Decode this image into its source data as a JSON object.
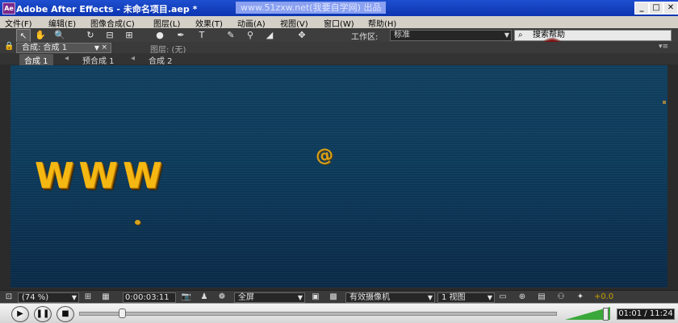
{
  "window": {
    "app_icon": "Ae",
    "title": "Adobe After Effects - 未命名项目.aep *",
    "watermark": "www.51zxw.net(我要自学网) 出品",
    "buttons": {
      "minimize": "_",
      "maximize": "□",
      "close": "✕"
    }
  },
  "menu": {
    "items": [
      "文件(F)",
      "编辑(E)",
      "图像合成(C)",
      "图层(L)",
      "效果(T)",
      "动画(A)",
      "视图(V)",
      "窗口(W)",
      "帮助(H)"
    ]
  },
  "toolbar": {
    "tools": [
      {
        "name": "selection-tool-icon",
        "glyph": "↖"
      },
      {
        "name": "hand-tool-icon",
        "glyph": "✋"
      },
      {
        "name": "zoom-tool-icon",
        "glyph": "🔍"
      },
      {
        "name": "rotate-tool-icon",
        "glyph": "↻"
      },
      {
        "name": "camera-tool-icon",
        "glyph": "⊟"
      },
      {
        "name": "pan-behind-tool-icon",
        "glyph": "⊞"
      },
      {
        "name": "ellipse-tool-icon",
        "glyph": "●"
      },
      {
        "name": "pen-tool-icon",
        "glyph": "✒"
      },
      {
        "name": "text-tool-icon",
        "glyph": "T"
      },
      {
        "name": "brush-tool-icon",
        "glyph": "✎"
      },
      {
        "name": "clone-stamp-tool-icon",
        "glyph": "⚲"
      },
      {
        "name": "eraser-tool-icon",
        "glyph": "◢"
      },
      {
        "name": "puppet-tool-icon",
        "glyph": "✥"
      }
    ],
    "workspace_label": "工作区:",
    "workspace_value": "标准",
    "search_placeholder": "搜索帮助"
  },
  "panel": {
    "composition_tab": "合成: 合成 1",
    "tab_close": "×",
    "layer_tab": "图层: (无)",
    "panel_menu": "▾≡"
  },
  "breadcrumbs": [
    "合成 1",
    "预合成 1",
    "合成 2"
  ],
  "viewer": {
    "main_text": "WWW",
    "small_glyph": "@"
  },
  "viewer_controls": {
    "magnification": "(74 %)",
    "timecode": "0:00:03:11",
    "resolution": "全屏",
    "camera": "有效摄像机",
    "views": "1 视图",
    "exposure": "+0.0"
  },
  "player": {
    "time": "01:01 / 11:24",
    "progress": 0.09,
    "volume": 0.9
  }
}
